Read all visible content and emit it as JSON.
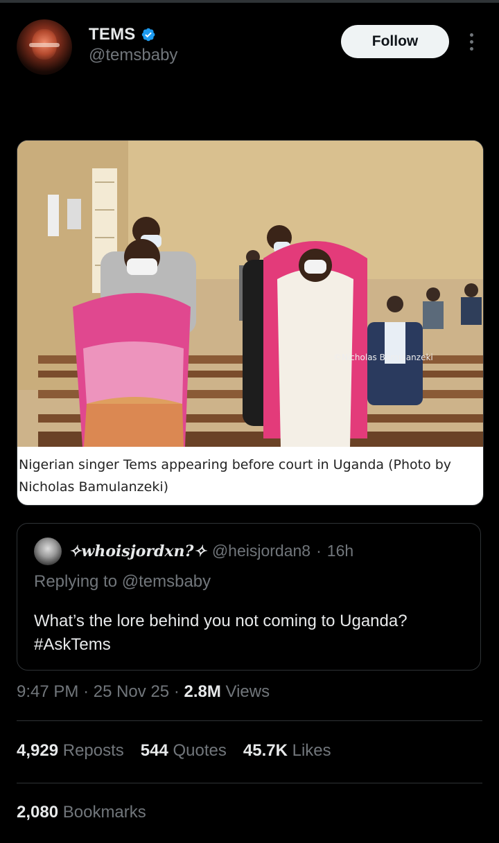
{
  "author": {
    "name": "TEMS",
    "handle": "@temsbaby",
    "verified_icon": "verified-badge-icon",
    "accent_color": "#1d9bf0"
  },
  "actions": {
    "follow_label": "Follow",
    "more_icon": "more-vertical-icon"
  },
  "media": {
    "caption": "Nigerian singer Tems appearing before court in Uganda (Photo by Nicholas Bamulanzeki)",
    "watermark": "©Nicholas Bamulanzeki"
  },
  "quoted_tweet": {
    "name": "✧whoisjordxn?✧",
    "handle": "@heisjordan8",
    "separator": "·",
    "time": "16h",
    "replying_to": "Replying to @temsbaby",
    "text": "What’s the lore behind you not coming to Uganda? #AskTems"
  },
  "meta": {
    "time": "9:47 PM",
    "date": "25 Nov 25",
    "separator": "·",
    "views_count": "2.8M",
    "views_label": "Views"
  },
  "stats": {
    "reposts_count": "4,929",
    "reposts_label": "Reposts",
    "quotes_count": "544",
    "quotes_label": "Quotes",
    "likes_count": "45.7K",
    "likes_label": "Likes",
    "bookmarks_count": "2,080",
    "bookmarks_label": "Bookmarks"
  }
}
